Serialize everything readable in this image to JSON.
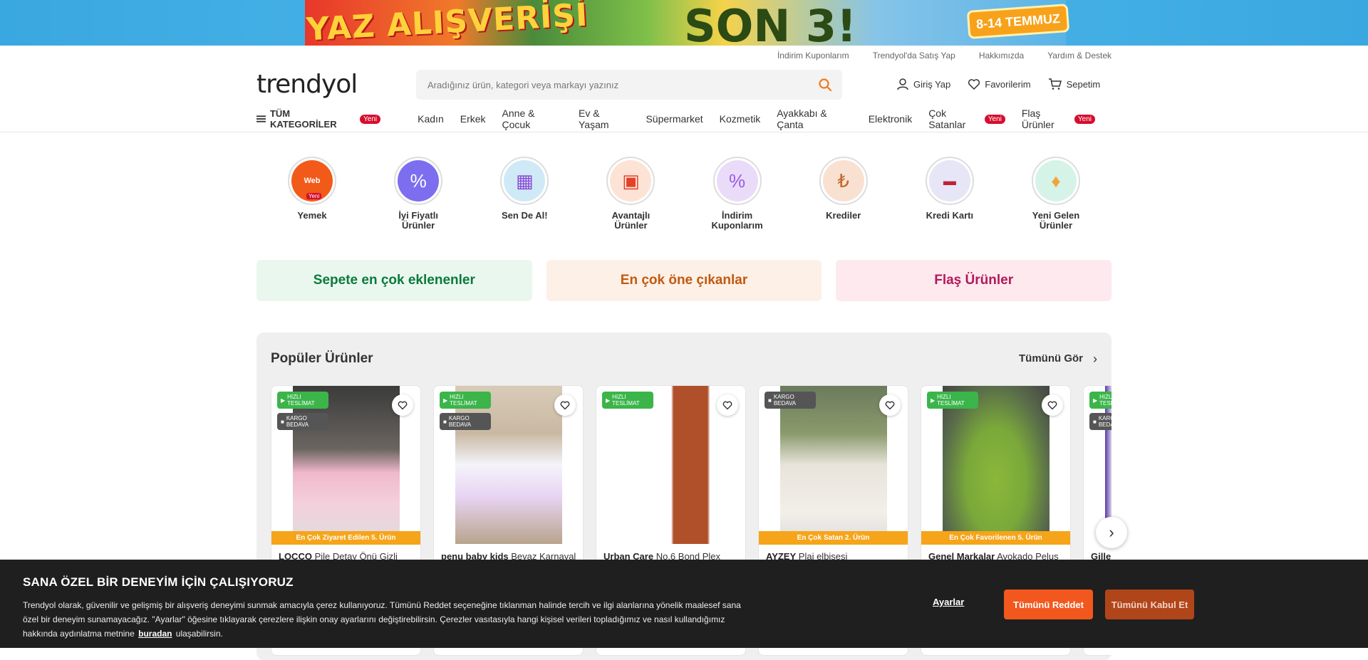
{
  "banner": {
    "left_text": "YAZ ALIŞVERİŞİ",
    "center_text": "SON 3!",
    "date_text": "8-14 TEMMUZ"
  },
  "top_links": [
    "İndirim Kuponlarım",
    "Trendyol'da Satış Yap",
    "Hakkımızda",
    "Yardım & Destek"
  ],
  "logo": "trendyol",
  "search": {
    "placeholder": "Aradığınız ürün, kategori veya markayı yazınız"
  },
  "user_actions": {
    "login": "Giriş Yap",
    "favorites": "Favorilerim",
    "cart": "Sepetim"
  },
  "nav": {
    "all_categories": "TÜM KATEGORİLER",
    "new_badge": "Yeni",
    "items": [
      "Kadın",
      "Erkek",
      "Anne & Çocuk",
      "Ev & Yaşam",
      "Süpermarket",
      "Kozmetik",
      "Ayakkabı & Çanta",
      "Elektronik",
      "Çok Satanlar",
      "Flaş Ürünler"
    ]
  },
  "circles": [
    {
      "label": "Yemek",
      "icon": "web-food-icon",
      "core_text": "Web",
      "badge": "Yeni"
    },
    {
      "label": "İyi Fiyatlı Ürünler",
      "icon": "percent-badge-icon"
    },
    {
      "label": "Sen De Al!",
      "icon": "shopping-bag-icon"
    },
    {
      "label": "Avantajlı Ürünler",
      "icon": "gift-icon"
    },
    {
      "label": "İndirim Kuponlarım",
      "icon": "coupon-icon"
    },
    {
      "label": "Krediler",
      "icon": "money-bag-icon"
    },
    {
      "label": "Kredi Kartı",
      "icon": "credit-card-icon"
    },
    {
      "label": "Yeni Gelen Ürünler",
      "icon": "bell-icon"
    }
  ],
  "tabs": [
    {
      "label": "Sepete en çok eklenenler",
      "bg": "#eaf7ef",
      "color": "#0b7a3b"
    },
    {
      "label": "En çok öne çıkanlar",
      "bg": "#fdf0e6",
      "color": "#c05a10"
    },
    {
      "label": "Flaş Ürünler",
      "bg": "#fde9ee",
      "color": "#b3185a"
    }
  ],
  "popular": {
    "title": "Popüler Ürünler",
    "see_all": "Tümünü Gör",
    "tag_fast": "HIZLI TESLİMAT",
    "tag_cargo": "KARGO BEDAVA",
    "products": [
      {
        "brand": "LOCCO",
        "name": "Pile Detay Önü Gizli",
        "rank": "En Çok Ziyaret Edilen 5. Ürün",
        "fast": true,
        "cargo": true
      },
      {
        "brand": "penu baby kids",
        "name": "Beyaz Karnaval",
        "rank": "",
        "fast": true,
        "cargo": true
      },
      {
        "brand": "Urban Care",
        "name": "No.6 Bond Plex",
        "rank": "",
        "fast": true,
        "cargo": false
      },
      {
        "brand": "AYZEY",
        "name": "Plaj elbisesi",
        "rank": "En Çok Satan 2. Ürün",
        "fast": false,
        "cargo": true
      },
      {
        "brand": "Genel Markalar",
        "name": "Avokado Pelus",
        "rank": "En Çok Favorilenen 5. Ürün",
        "fast": true,
        "cargo": false
      },
      {
        "brand": "Gille",
        "name": "",
        "rank": "",
        "fast": true,
        "cargo": true
      }
    ]
  },
  "cookie": {
    "title": "SANA ÖZEL BİR DENEYİM İÇİN ÇALIŞIYORUZ",
    "text_before": "Trendyol olarak, güvenilir ve gelişmiş bir alışveriş deneyimi sunmak amacıyla çerez kullanıyoruz. Tümünü Reddet seçeneğine tıklanman halinde tercih ve ilgi alanlarına yönelik maalesef sana özel bir deneyim sunamayacağız. \"Ayarlar\" öğesine tıklayarak çerezlere ilişkin onay ayarlarını değiştirebilirsin. Çerezler vasıtasıyla hangi kişisel verileri topladığımız ve nasıl kullandığımız hakkında aydınlatma metnine",
    "link": "buradan",
    "text_after": "ulaşabilirsin.",
    "settings": "Ayarlar",
    "reject": "Tümünü Reddet",
    "accept": "Tümünü Kabul Et"
  },
  "colors": {
    "brand_orange": "#f27a1a",
    "badge_red": "#d60d2d"
  }
}
